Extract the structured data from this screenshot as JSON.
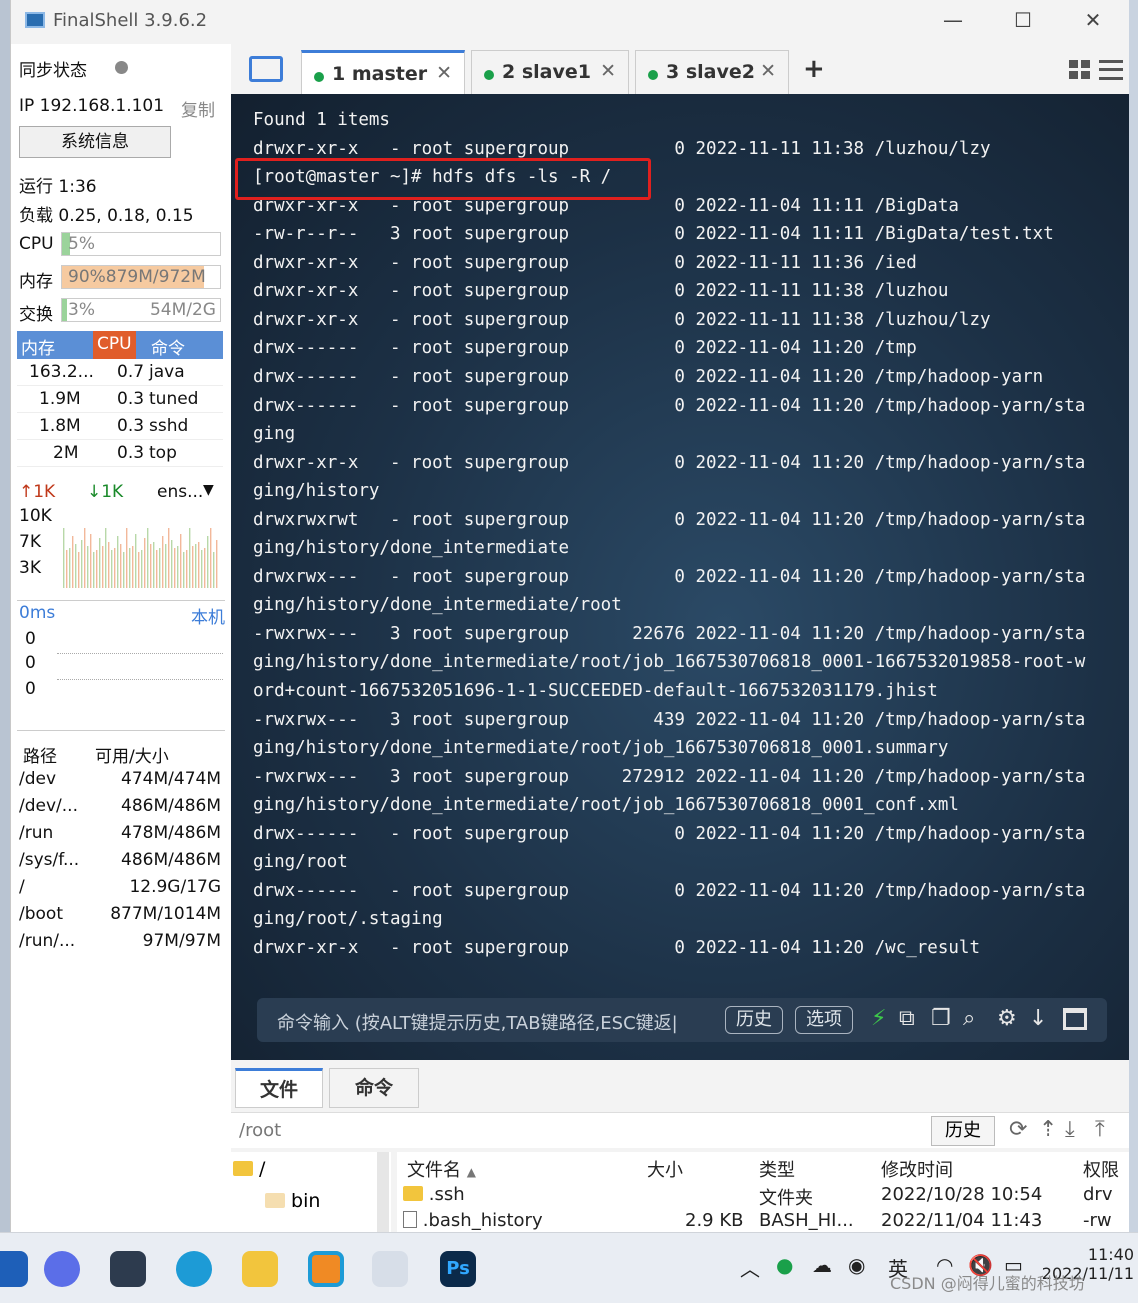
{
  "window": {
    "title": "FinalShell 3.9.6.2",
    "minimize": "—",
    "maximize": "☐",
    "close": "✕"
  },
  "sidebar": {
    "sync_label": "同步状态",
    "ip": "IP 192.168.1.101",
    "copy": "复制",
    "sysinfo_button": "系统信息",
    "uptime": "运行 1:36",
    "load": "负载 0.25, 0.18, 0.15",
    "cpu_label": "CPU",
    "cpu_value": "5%",
    "cpu_pct": 5,
    "mem_label": "内存",
    "mem_value": "90%879M/972M",
    "mem_pct": 90,
    "swap_label": "交换",
    "swap_value": "3%",
    "swap_detail": "54M/2G",
    "swap_pct": 3,
    "proc_headers": [
      "内存",
      "CPU",
      "命令"
    ],
    "processes": [
      {
        "mem": "163.2...",
        "cpu": "0.7",
        "cmd": "java"
      },
      {
        "mem": "1.9M",
        "cpu": "0.3",
        "cmd": "tuned"
      },
      {
        "mem": "1.8M",
        "cpu": "0.3",
        "cmd": "sshd"
      },
      {
        "mem": "2M",
        "cpu": "0.3",
        "cmd": "top"
      }
    ],
    "net_up": "↑1K",
    "net_down": "↓1K",
    "net_iface": "ens...",
    "net_scale": [
      "10K",
      "7K",
      "3K"
    ],
    "latency": "0ms",
    "latency_target": "本机",
    "latency_values": [
      "0",
      "0",
      "0"
    ],
    "disk_headers": [
      "路径",
      "可用/大小"
    ],
    "disks": [
      {
        "path": "/dev",
        "size": "474M/474M"
      },
      {
        "path": "/dev/...",
        "size": "486M/486M"
      },
      {
        "path": "/run",
        "size": "478M/486M"
      },
      {
        "path": "/sys/f...",
        "size": "486M/486M"
      },
      {
        "path": "/",
        "size": "12.9G/17G"
      },
      {
        "path": "/boot",
        "size": "877M/1014M"
      },
      {
        "path": "/run/...",
        "size": "97M/97M"
      }
    ]
  },
  "tabs": [
    {
      "label": "1 master",
      "close": "✕"
    },
    {
      "label": "2 slave1",
      "close": "✕"
    },
    {
      "label": "3 slave2",
      "close": "✕"
    }
  ],
  "add_tab": "+",
  "terminal": {
    "lines": [
      "Found 1 items",
      "drwxr-xr-x   - root supergroup          0 2022-11-11 11:38 /luzhou/lzy",
      "[root@master ~]# hdfs dfs -ls -R /",
      "drwxr-xr-x   - root supergroup          0 2022-11-04 11:11 /BigData",
      "-rw-r--r--   3 root supergroup          0 2022-11-04 11:11 /BigData/test.txt",
      "drwxr-xr-x   - root supergroup          0 2022-11-11 11:36 /ied",
      "drwxr-xr-x   - root supergroup          0 2022-11-11 11:38 /luzhou",
      "drwxr-xr-x   - root supergroup          0 2022-11-11 11:38 /luzhou/lzy",
      "drwx------   - root supergroup          0 2022-11-04 11:20 /tmp",
      "drwx------   - root supergroup          0 2022-11-04 11:20 /tmp/hadoop-yarn",
      "drwx------   - root supergroup          0 2022-11-04 11:20 /tmp/hadoop-yarn/sta",
      "ging",
      "drwxr-xr-x   - root supergroup          0 2022-11-04 11:20 /tmp/hadoop-yarn/sta",
      "ging/history",
      "drwxrwxrwt   - root supergroup          0 2022-11-04 11:20 /tmp/hadoop-yarn/sta",
      "ging/history/done_intermediate",
      "drwxrwx---   - root supergroup          0 2022-11-04 11:20 /tmp/hadoop-yarn/sta",
      "ging/history/done_intermediate/root",
      "-rwxrwx---   3 root supergroup      22676 2022-11-04 11:20 /tmp/hadoop-yarn/sta",
      "ging/history/done_intermediate/root/job_1667530706818_0001-1667532019858-root-w",
      "ord+count-1667532051696-1-1-SUCCEEDED-default-1667532031179.jhist",
      "-rwxrwx---   3 root supergroup        439 2022-11-04 11:20 /tmp/hadoop-yarn/sta",
      "ging/history/done_intermediate/root/job_1667530706818_0001.summary",
      "-rwxrwx---   3 root supergroup     272912 2022-11-04 11:20 /tmp/hadoop-yarn/sta",
      "ging/history/done_intermediate/root/job_1667530706818_0001_conf.xml",
      "drwx------   - root supergroup          0 2022-11-04 11:20 /tmp/hadoop-yarn/sta",
      "ging/root",
      "drwx------   - root supergroup          0 2022-11-04 11:20 /tmp/hadoop-yarn/sta",
      "ging/root/.staging",
      "drwxr-xr-x   - root supergroup          0 2022-11-04 11:20 /wc_result"
    ],
    "command_placeholder": "命令输入 (按ALT键提示历史,TAB键路径,ESC键返|",
    "history_button": "历史",
    "options_button": "选项"
  },
  "bottom": {
    "tabs": [
      "文件",
      "命令"
    ],
    "path": "/root",
    "history_button": "历史",
    "tree": [
      "/",
      "bin"
    ],
    "columns": [
      "文件名",
      "大小",
      "类型",
      "修改时间",
      "权限"
    ],
    "files": [
      {
        "name": ".ssh",
        "size": "",
        "type": "文件夹",
        "modified": "2022/10/28 10:54",
        "perm": "drv"
      },
      {
        "name": ".bash_history",
        "size": "2.9 KB",
        "type": "BASH_HI...",
        "modified": "2022/11/04 11:43",
        "perm": "-rw"
      }
    ]
  },
  "taskbar": {
    "ime": "英",
    "time": "11:40",
    "date": "2022/11/11",
    "watermark": "CSDN @闷得儿蜜的科技坊"
  },
  "colors": {
    "accent": "#3d7dd8",
    "terminal_bg": "#1c3045",
    "highlight": "#e0201e",
    "online_dot": "#1aa04a"
  }
}
